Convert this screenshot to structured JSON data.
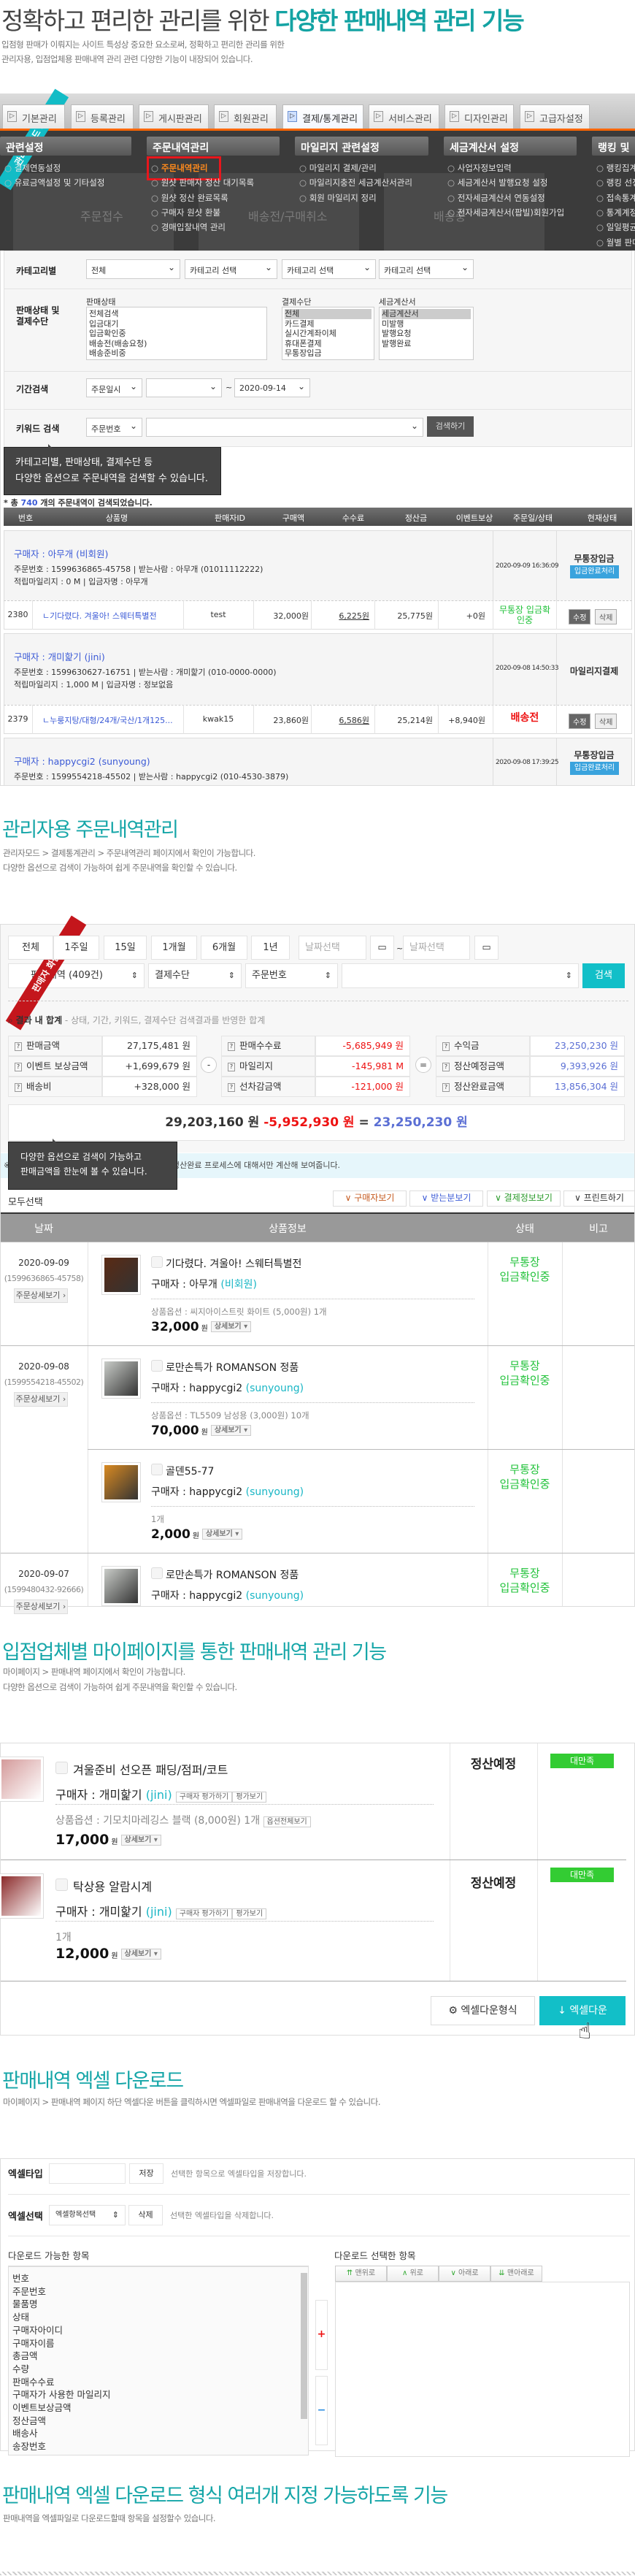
{
  "hero": {
    "title_plain": "정확하고 편리한 관리를 위한 ",
    "title_accent": "다양한 판매내역 관리 기능",
    "desc": [
      "입점형 판매가 이뤄지는 사이트 특성상 중요한 요소로써, 정확하고 편리한 관리를 위한",
      "관리자용, 입점업체용 판매내역 관리 관련 다양한 기능이 내장되어 있습니다."
    ]
  },
  "admin": {
    "ribbon": "관리자모드 화면",
    "tabs": [
      "기본관리",
      "등록관리",
      "게시판관리",
      "회원관리",
      "결제/통계관리",
      "서비스관리",
      "디자인관리",
      "고급자설정"
    ],
    "menu_headers": [
      "관련설정",
      "주문내역관리",
      "마일리지 관련설정",
      "세금계산서 설정",
      "랭킹 및"
    ],
    "menu_columns": [
      [
        "결제연동설정",
        "유료금액설정 및 기타설정"
      ],
      [
        "주문내역관리",
        "원샷 판매자 정산 대기목록",
        "원샷 정산 완료목록",
        "구매자 원샷 환불",
        "경매입찰내역 관리"
      ],
      [
        "마일리지 결제/관리",
        "마일리지충전 세금계산서관리",
        "회원 마일리지 정리"
      ],
      [
        "사업자정보입력",
        "세금계산서 발행요청 설정",
        "전자세금계산서 연동설정",
        "전자세금계산서(팝빌)회원가입"
      ],
      [
        "랭킹집계",
        "랭킹 선정",
        "접속통계",
        "통계계정",
        "일일평균",
        "월별 판매"
      ]
    ],
    "bg_labels": [
      "주문접수",
      "배송전/구매취소",
      "배송중"
    ],
    "filters": {
      "category_label": "카테고리별",
      "category_selects": [
        "전체",
        "카테고리 선택",
        "카테고리 선택",
        "카테고리 선택"
      ],
      "status_label": "판매상태 및 결제수단",
      "status_heading": "판매상태",
      "status_options": [
        "전체검색",
        "입금대기",
        "입금확인중",
        "배송전(배송요청)",
        "배송준비중"
      ],
      "payment_heading": "결제수단",
      "payment_options": [
        "전체",
        "카드결제",
        "실시간계좌이체",
        "휴대폰결제",
        "무통장입금"
      ],
      "tax_heading": "세금계산서",
      "tax_options": [
        "세금계산서",
        "미발행",
        "발행요청",
        "발행완료"
      ],
      "period_label": "기간검색",
      "period_select": "주문일시",
      "date_from": "",
      "date_to": "2020-09-14",
      "tilde": "~",
      "keyword_label": "키워드 검색",
      "keyword_select": "주문번호",
      "keyword_value": "",
      "search_button": "검색하기"
    },
    "tooltip": [
      "카테고리별, 판매상태, 결제수단 등",
      "다양한 옵션으로 주문내역을 검색할 수 있습니다."
    ],
    "count": {
      "pre": "* 총 ",
      "num": "740",
      "post": " 개의 주문내역이 검색되었습니다."
    },
    "table_headers": [
      "번호",
      "상품명",
      "판매자ID",
      "구매액",
      "수수료",
      "정산금",
      "이벤트보상",
      "주문일/상태",
      "현재상태"
    ],
    "orders": [
      {
        "buyer": "구매자 : 아무개 (비회원)",
        "order_line": "주문번호 : 1599636865-45758 | 받는사람 : 아무개 (01011112222)",
        "mileage_line": "적립마일리지 : 0 M | 입금자명 : 아무개",
        "date": "2020-09-09 16:36:09",
        "pay": "무통장입금",
        "action": "입금완료처리",
        "item": {
          "no": "2380",
          "name": "ㄴ기다렸다. 겨울아! 스웨터특별전",
          "seller": "test",
          "amount": "32,000원",
          "fee": "6,225원",
          "settle": "25,775원",
          "event": "+0원",
          "status": "무통장 입금확인중",
          "edit": "수정",
          "del": "삭제"
        }
      },
      {
        "buyer": "구매자 : 개미핥기 (jini)",
        "order_line": "주문번호 : 1599630627-16751 | 받는사람 : 개미핥기 (010-0000-0000)",
        "mileage_line": "적립마일리지 : 1,000 M | 입금자명 : 정보없음",
        "date": "2020-09-08 14:50:33",
        "pay": "마일리지결제",
        "item": {
          "no": "2379",
          "name": "ㄴ누룽지탕/대형/24개/국산/1개125...",
          "seller": "kwak15",
          "amount": "23,860원",
          "fee": "6,586원",
          "settle": "25,214원",
          "event": "+8,940원",
          "status": "배송전",
          "edit": "수정",
          "del": "삭제"
        }
      },
      {
        "buyer": "구매자 : happycgi2 (sunyoung)",
        "order_line": "주문번호 : 1599554218-45502 | 받는사람 : happycgi2 (010-4530-3879)",
        "date": "2020-09-08 17:39:25",
        "pay": "무통장입금",
        "action": "입금완료처리"
      }
    ]
  },
  "sec2": {
    "title": "관리자용 주문내역관리",
    "desc": [
      "관리자모드 > 결제통계관리 > 주문내역관리 페이지에서 확인이 가능합니다.",
      "다양한 옵션으로 검색이 가능하여 쉽게 주문내역을 확인할 수 있습니다."
    ]
  },
  "seller": {
    "ribbon": "판매자 화면",
    "periods": [
      "전체",
      "1주일",
      "15일",
      "1개월",
      "6개월",
      "1년"
    ],
    "date_placeholder": "날짜선택",
    "tilde": "~",
    "selects": [
      "판매내역 (409건)",
      "결제수단",
      "주문번호"
    ],
    "search": "검색",
    "sum_title": "결과 내 합계",
    "sum_sub": " - 상태, 기간, 키워드, 결제수단 검색결과를 반영한 합계",
    "sum_left": [
      {
        "k": "판매금액",
        "v": "27,175,481 원"
      },
      {
        "k": "이벤트 보상금액",
        "v": "+1,699,679 원"
      },
      {
        "k": "배송비",
        "v": "+328,000 원"
      }
    ],
    "sum_mid": [
      {
        "k": "판매수수료",
        "v": "-5,685,949 원"
      },
      {
        "k": "마일리지",
        "v": "-145,981 M"
      },
      {
        "k": "선차감금액",
        "v": "-121,000 원"
      }
    ],
    "sum_right": [
      {
        "k": "수익금",
        "v": "23,250,230 원"
      },
      {
        "k": "정산예정금액",
        "v": "9,393,926 원"
      },
      {
        "k": "정산완료금액",
        "v": "13,856,304 원"
      }
    ],
    "minus": "-",
    "equals": "=",
    "total": {
      "a": "29,203,160 원",
      "b": " -5,952,930 원",
      "eq": " = ",
      "c": "23,250,230 원"
    },
    "info": "※ [안내] 전체판매내역 검색시 수익금은 정산예정 정산완료 프로세스에 대해서만 계산해 보여줍니다.",
    "tooltip": [
      "다양한 옵션으로 검색이 가능하고",
      "판매금액을 한눈에 볼 수 있습니다."
    ],
    "select_all": "모두선택",
    "view_buttons": [
      "구매자보기",
      "받는분보기",
      "결제정보보기",
      "프린트하기"
    ],
    "headers": [
      "날짜",
      "상품정보",
      "상태",
      "비고"
    ],
    "detail_btn": "주문상세보기",
    "more_btn": "상세보기",
    "buyer_pre": "구매자 : ",
    "rows": [
      {
        "date": "2020-09-09",
        "order": "(1599636865-45758)",
        "name": "기다렸다. 겨울아! 스웨터특별전",
        "buyer": "아무개",
        "buyer_id": "(비회원)",
        "option": "상품옵션 : 씨지아이스트릿 화이트 (5,000원) 1개",
        "price": "32,000",
        "unit": "원",
        "status": [
          "무통장",
          "입금확인중"
        ]
      },
      {
        "date": "2020-09-08",
        "order": "(1599554218-45502)",
        "name": "로만손특가 ROMANSON 정품",
        "buyer": "happycgi2",
        "buyer_id": "(sunyoung)",
        "option": "상품옵션 : TL5509 남성용 (3,000원) 10개",
        "price": "70,000",
        "unit": "원",
        "status": [
          "무통장",
          "입금확인중"
        ]
      },
      {
        "name": "골덴55-77",
        "buyer": "happycgi2",
        "buyer_id": "(sunyoung)",
        "option": "1개",
        "price": "2,000",
        "unit": "원",
        "status": [
          "무통장",
          "입금확인중"
        ]
      },
      {
        "date": "2020-09-07",
        "order": "(1599480432-92666)",
        "name": "로만손특가 ROMANSON 정품",
        "buyer": "happycgi2",
        "buyer_id": "(sunyoung)",
        "status": [
          "무통장",
          "입금확인중"
        ]
      }
    ]
  },
  "sec3": {
    "title": "입점업체별 마이페이지를 통한 판매내역 관리 기능",
    "desc": [
      "마이페이지 > 판매내역 페이지에서 확인이 가능합니다.",
      "다양한 옵션으로 검색이 가능하여 쉽게 주문내역을 확인할 수 있습니다."
    ]
  },
  "mypage": {
    "buyer_pre": "구매자 : ",
    "rate_btn": "구매자 평가하기",
    "view_rate_btn": "평가보기",
    "more_btn": "상세보기",
    "option_btn": "옵션전체보기",
    "rows": [
      {
        "name": "겨울준비 선오픈 패딩/점퍼/코트",
        "buyer": "개미핥기",
        "buyer_id": "(jini)",
        "option": "상품옵션 : 기모치마레깅스 블랙 (8,000원) 1개",
        "price": "17,000",
        "unit": "원",
        "settle": "정산예정",
        "rating": "대만족"
      },
      {
        "name": "탁상용 알람시계",
        "buyer": "개미핥기",
        "buyer_id": "(jini)",
        "option": "1개",
        "price": "12,000",
        "unit": "원",
        "settle": "정산예정",
        "rating": "대만족"
      }
    ],
    "excel_format_btn": "엑셀다운형식",
    "excel_down_btn": "엑셀다운"
  },
  "sec4": {
    "title": "판매내역 엑셀 다운로드",
    "desc": "마이페이지 > 판매내역 페이지 하단 엑셀다운 버튼을 클릭하시면 엑셀파일로 판매내역을 다운로드 할 수 있습니다."
  },
  "excel": {
    "type_label": "엑셀타입",
    "type_value": "",
    "save_btn": "저장",
    "save_hint": "선택한 항목으로 엑셀타입을 저장합니다.",
    "select_label": "엑셀선택",
    "select_value": "엑셀항목선택",
    "delete_btn": "삭제",
    "delete_hint": "선택한 엑셀타입을 삭제합니다.",
    "available_title": "다운로드 가능한 항목",
    "selected_title": "다운로드 선택한 항목",
    "available": [
      "번호",
      "주문번호",
      "물품명",
      "상태",
      "구매자아이디",
      "구매자이름",
      "총금액",
      "수량",
      "판매수수료",
      "구매자가 사용한 마일리지",
      "이벤트보상금액",
      "정산금액",
      "배송사",
      "송장번호"
    ],
    "order_buttons": [
      "맨위로",
      "위로",
      "아래로",
      "맨아래로"
    ],
    "add": "+",
    "remove": "−"
  },
  "sec5": {
    "title": "판매내역 엑셀 다운로드 형식 여러개 지정 가능하도록 기능",
    "desc": "판매내역을 엑셀파일로 다운로드할때 항목을 설정할수 있습니다."
  },
  "colors": {
    "teal": "#14a3a3",
    "button_teal": "#12bfc8",
    "status_green": "#21c23a",
    "ribbon_red": "#c4161c",
    "rating_green": "#33cc33",
    "orange": "#ff6600"
  }
}
